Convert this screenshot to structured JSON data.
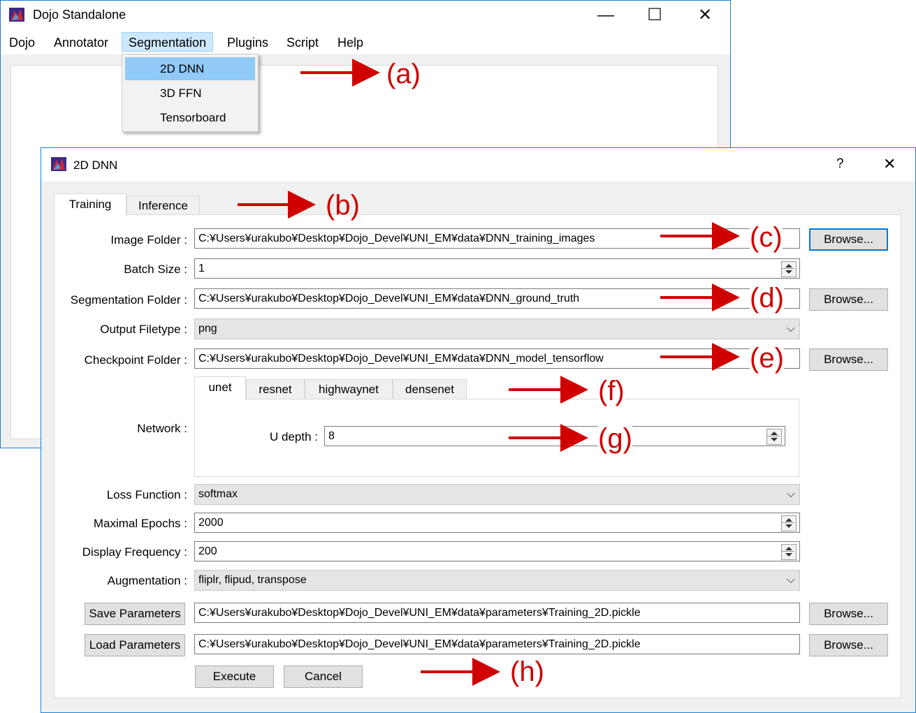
{
  "main_window": {
    "title": "Dojo Standalone",
    "menu": [
      "Dojo",
      "Annotator",
      "Segmentation",
      "Plugins",
      "Script",
      "Help"
    ],
    "segmentation_menu": [
      "2D DNN",
      "3D FFN",
      "Tensorboard"
    ],
    "caption": {
      "minimize": "—",
      "maximize": "☐",
      "close": "✕"
    }
  },
  "dialog": {
    "title": "2D DNN",
    "help": "?",
    "close": "✕",
    "tabs": [
      "Training",
      "Inference"
    ],
    "image_folder": {
      "label": "Image Folder :",
      "value": "C:¥Users¥urakubo¥Desktop¥Dojo_Devel¥UNI_EM¥data¥DNN_training_images",
      "button": "Browse..."
    },
    "batch_size": {
      "label": "Batch Size :",
      "value": "1"
    },
    "segmentation_folder": {
      "label": "Segmentation Folder :",
      "value": "C:¥Users¥urakubo¥Desktop¥Dojo_Devel¥UNI_EM¥data¥DNN_ground_truth",
      "button": "Browse..."
    },
    "output_filetype": {
      "label": "Output Filetype :",
      "value": "png"
    },
    "checkpoint_folder": {
      "label": "Checkpoint Folder :",
      "value": "C:¥Users¥urakubo¥Desktop¥Dojo_Devel¥UNI_EM¥data¥DNN_model_tensorflow",
      "button": "Browse..."
    },
    "network": {
      "label": "Network :",
      "tabs": [
        "unet",
        "resnet",
        "highwaynet",
        "densenet"
      ],
      "u_depth": {
        "label": "U depth :",
        "value": "8"
      }
    },
    "loss_function": {
      "label": "Loss Function :",
      "value": "softmax"
    },
    "maximal_epochs": {
      "label": "Maximal Epochs :",
      "value": "2000"
    },
    "display_frequency": {
      "label": "Display Frequency :",
      "value": "200"
    },
    "augmentation": {
      "label": "Augmentation :",
      "value": "fliplr, flipud, transpose"
    },
    "save_parameters": {
      "button": "Save Parameters",
      "value": "C:¥Users¥urakubo¥Desktop¥Dojo_Devel¥UNI_EM¥data¥parameters¥Training_2D.pickle",
      "browse": "Browse..."
    },
    "load_parameters": {
      "button": "Load Parameters",
      "value": "C:¥Users¥urakubo¥Desktop¥Dojo_Devel¥UNI_EM¥data¥parameters¥Training_2D.pickle",
      "browse": "Browse..."
    },
    "execute": "Execute",
    "cancel": "Cancel"
  },
  "annotations": [
    "(a)",
    "(b)",
    "(c)",
    "(d)",
    "(e)",
    "(f)",
    "(g)",
    "(h)"
  ],
  "colors": {
    "annotation": "#d00000",
    "accent": "#1883d7",
    "menu_highlight": "#91c9f7"
  }
}
